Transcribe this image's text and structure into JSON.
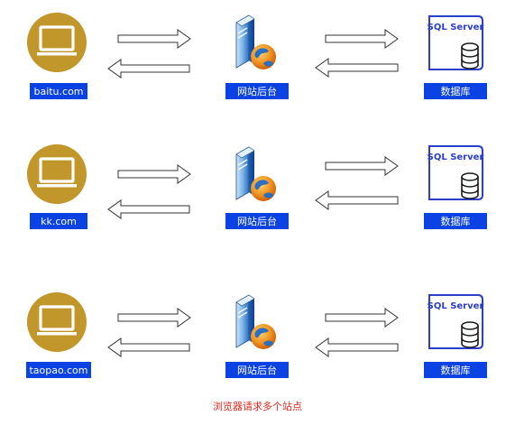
{
  "colors": {
    "monitor_gold": "#c1962a",
    "label_blue": "#0b42e3",
    "db_blue": "#2b3ec9",
    "server_blue": "#1d6bc7",
    "caption_red": "#e0281e"
  },
  "rows": [
    {
      "site": "baitu.com",
      "backend": "网站后台",
      "database_brand": "SQL Server",
      "database": "数据库"
    },
    {
      "site": "kk.com",
      "backend": "网站后台",
      "database_brand": "SQL Server",
      "database": "数据库"
    },
    {
      "site": "taopao.com",
      "backend": "网站后台",
      "database_brand": "SQL Server",
      "database": "数据库"
    }
  ],
  "caption": "浏览器请求多个站点"
}
